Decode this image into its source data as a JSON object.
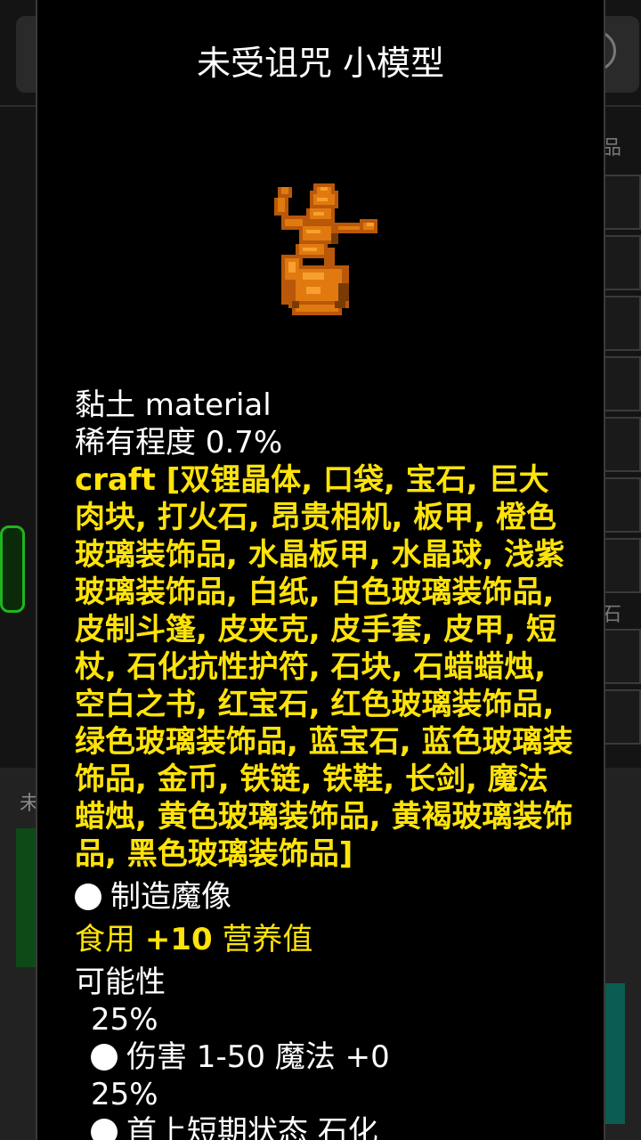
{
  "dialog": {
    "title": "未受诅咒 小模型",
    "material_line": "黏土 material",
    "rarity_line": "稀有程度 0.7%",
    "craft_label": "craft",
    "craft_items": "[双锂晶体, 口袋, 宝石, 巨大肉块, 打火石, 昂贵相机, 板甲, 橙色玻璃装饰品, 水晶板甲, 水晶球, 浅紫玻璃装饰品, 白纸, 白色玻璃装饰品, 皮制斗篷, 皮夹克, 皮手套, 皮甲, 短杖, 石化抗性护符, 石块, 石蜡蜡烛, 空白之书, 红宝石, 红色玻璃装饰品, 绿色玻璃装饰品, 蓝宝石, 蓝色玻璃装饰品, 金币, 铁链, 铁鞋, 长剑, 魔法蜡烛, 黄色玻璃装饰品, 黄褐玻璃装饰品, 黑色玻璃装饰品]",
    "make_golem": "制造魔像",
    "eat_prefix": "食用",
    "eat_value": "+10",
    "eat_suffix": "营养值",
    "possibility_label": "可能性",
    "outcomes": [
      {
        "chance": "25%",
        "effect": "伤害 1-50 魔法 +0"
      },
      {
        "chance": "25%",
        "effect": "首上短期状态 石化"
      }
    ]
  },
  "background": {
    "right_label_top": "品",
    "right_label_mid": "石",
    "bottom_label": "未"
  },
  "colors": {
    "accent_yellow": "#ffe30a",
    "sprite_orange": "#e07a10",
    "green": "#1fb51f"
  },
  "icons": [
    "figurine-sprite-icon",
    "bullet-icon"
  ]
}
